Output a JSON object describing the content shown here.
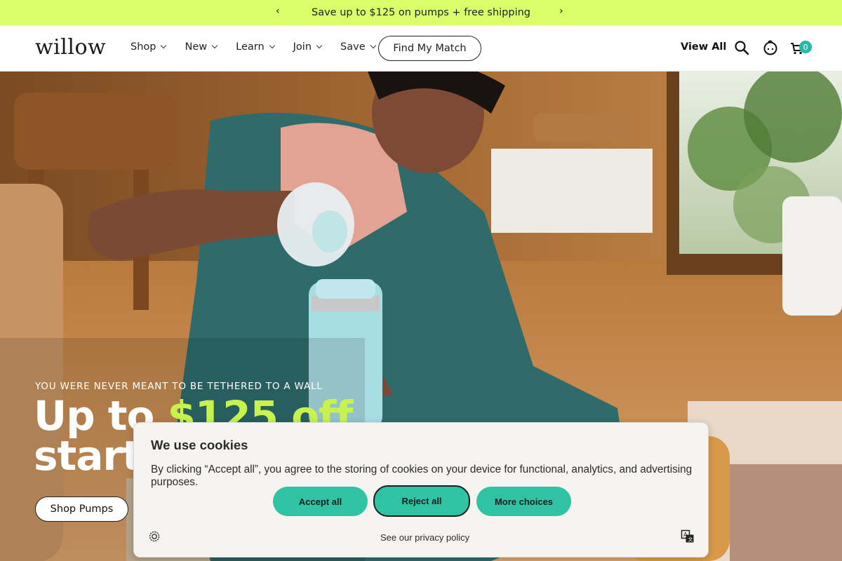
{
  "promo": {
    "text": "Save up to $125 on pumps + free shipping",
    "prev_icon": "chevron-left-icon",
    "next_icon": "chevron-right-icon",
    "prev_glyph": "‹",
    "next_glyph": "›",
    "bg_color": "#d9ff6b"
  },
  "header": {
    "logo": "willow",
    "nav": [
      {
        "label": "Shop"
      },
      {
        "label": "New"
      },
      {
        "label": "Learn"
      },
      {
        "label": "Join"
      },
      {
        "label": "Save"
      }
    ],
    "match_button": "Find My Match",
    "view_all": "View All",
    "search_icon": "search-icon",
    "account_icon": "account-icon",
    "cart_icon": "cart-icon",
    "cart_count": "0",
    "badge_color": "#27b9a6"
  },
  "hero": {
    "eyebrow": "YOU WERE NEVER MEANT TO BE TETHERED TO A WALL",
    "title_prefix": "Up to ",
    "title_accent": "$125 off",
    "title_line2": "starts",
    "cta": "Shop Pumps",
    "accent_color": "#c8f24d"
  },
  "cookie": {
    "title": "We use cookies",
    "description": "By clicking “Accept all”, you agree to the storing of cookies on your device for functional, analytics, and advertising purposes.",
    "accept": "Accept all",
    "reject": "Reject all",
    "more": "More choices",
    "privacy_link": "See our privacy policy",
    "settings_icon": "settings-icon",
    "language_icon": "language-icon",
    "button_color": "#2fc3a3"
  }
}
